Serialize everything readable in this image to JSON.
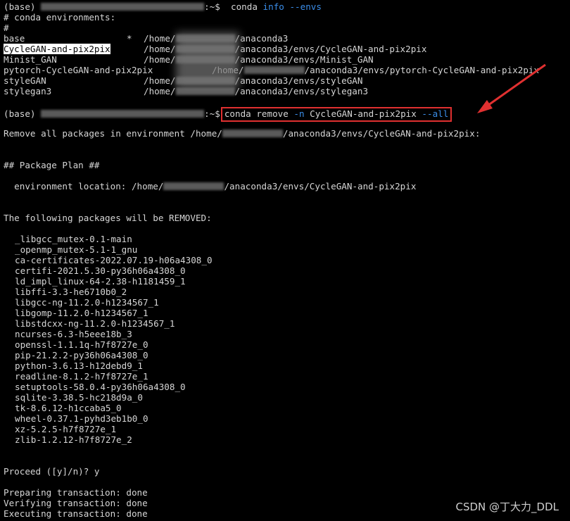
{
  "prompt": {
    "env": "(base)",
    "suffix": ":~$"
  },
  "cmd1": {
    "conda": "conda",
    "sub": "info",
    "flag": "--envs"
  },
  "env_header": "# conda environments:",
  "hash": "#",
  "envs": [
    {
      "name": "base",
      "star": "*",
      "pre": "/home/",
      "post": "/anaconda3"
    },
    {
      "name": "CycleGAN-and-pix2pix",
      "star": "",
      "pre": "/home/",
      "post": "/anaconda3/envs/CycleGAN-and-pix2pix"
    },
    {
      "name": "Minist_GAN",
      "star": "",
      "pre": "/home/",
      "post": "/anaconda3/envs/Minist_GAN"
    },
    {
      "name": "pytorch-CycleGAN-and-pix2pix",
      "star": "",
      "pre": "/home/",
      "post": "/anaconda3/envs/pytorch-CycleGAN-and-pix2pix"
    },
    {
      "name": "styleGAN",
      "star": "",
      "pre": "/home/",
      "post": "/anaconda3/envs/styleGAN"
    },
    {
      "name": "stylegan3",
      "star": "",
      "pre": "/home/",
      "post": "/anaconda3/envs/stylegan3"
    }
  ],
  "cmd2": {
    "text1": "conda remove ",
    "flag_n": "-n",
    "text2": " CycleGAN-and-pix2pix ",
    "flag_all": "--all"
  },
  "remove_msg_pre": "Remove all packages in environment /home/",
  "remove_msg_post": "/anaconda3/envs/CycleGAN-and-pix2pix:",
  "plan_header": "## Package Plan ##",
  "env_loc_pre": "  environment location: /home/",
  "env_loc_post": "/anaconda3/envs/CycleGAN-and-pix2pix",
  "removed_header": "The following packages will be REMOVED:",
  "packages": [
    "_libgcc_mutex-0.1-main",
    "_openmp_mutex-5.1-1_gnu",
    "ca-certificates-2022.07.19-h06a4308_0",
    "certifi-2021.5.30-py36h06a4308_0",
    "ld_impl_linux-64-2.38-h1181459_1",
    "libffi-3.3-he6710b0_2",
    "libgcc-ng-11.2.0-h1234567_1",
    "libgomp-11.2.0-h1234567_1",
    "libstdcxx-ng-11.2.0-h1234567_1",
    "ncurses-6.3-h5eee18b_3",
    "openssl-1.1.1q-h7f8727e_0",
    "pip-21.2.2-py36h06a4308_0",
    "python-3.6.13-h12debd9_1",
    "readline-8.1.2-h7f8727e_1",
    "setuptools-58.0.4-py36h06a4308_0",
    "sqlite-3.38.5-hc218d9a_0",
    "tk-8.6.12-h1ccaba5_0",
    "wheel-0.37.1-pyhd3eb1b0_0",
    "xz-5.2.5-h7f8727e_1",
    "zlib-1.2.12-h7f8727e_2"
  ],
  "proceed": "Proceed ([y]/n)? y",
  "status": [
    "Preparing transaction: done",
    "Verifying transaction: done",
    "Executing transaction: done"
  ],
  "watermark": "CSDN @丁大力_DDL",
  "colors": {
    "background": "#000000",
    "text": "#d6d6d6",
    "flag_blue": "#3b8eea",
    "annotation_red": "#e03030"
  }
}
